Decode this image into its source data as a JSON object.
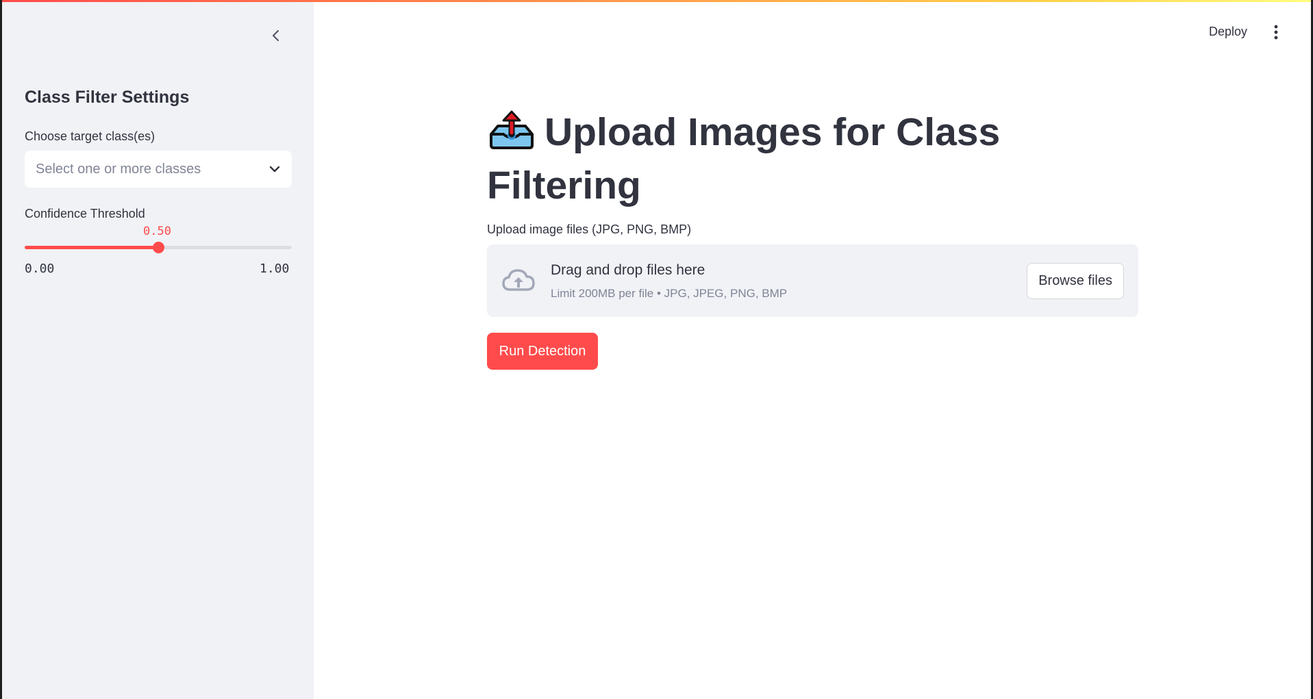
{
  "sidebar": {
    "title": "Class Filter Settings",
    "class_select": {
      "label": "Choose target class(es)",
      "placeholder": "Select one or more classes"
    },
    "confidence": {
      "label": "Confidence Threshold",
      "value_label": "0.50",
      "value": 0.5,
      "min_label": "0.00",
      "max_label": "1.00"
    }
  },
  "header": {
    "deploy_label": "Deploy"
  },
  "main": {
    "title": "Upload Images for Class Filtering",
    "uploader": {
      "label": "Upload image files (JPG, PNG, BMP)",
      "drop_text": "Drag and drop files here",
      "limit_text": "Limit 200MB per file • JPG, JPEG, PNG, BMP",
      "browse_label": "Browse files"
    },
    "run_button_label": "Run Detection"
  },
  "colors": {
    "accent": "#ff4b4b",
    "sidebar_bg": "#f0f2f6",
    "text": "#31333f",
    "muted": "#808495"
  },
  "icons": {
    "collapse": "chevron-left-icon",
    "select_arrow": "chevron-down-icon",
    "menu": "kebab-menu-icon",
    "title": "outbox-tray-emoji-icon",
    "upload": "cloud-upload-icon"
  }
}
